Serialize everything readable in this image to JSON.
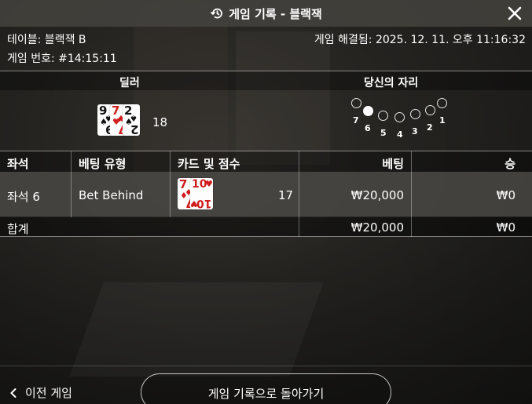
{
  "header": {
    "title": "게임 기록 - 블랙잭",
    "history_icon": "history-icon",
    "close_icon": "close-icon"
  },
  "info": {
    "table": "테이블: 블랙잭 B",
    "round": "게임 번호: #14:15:11",
    "resolved": "게임 해결됨: 2025. 12. 11. 오후 11:16:32"
  },
  "dealer": {
    "label": "딜러",
    "cards": [
      {
        "rank": "9",
        "suit": "♠",
        "color": "black"
      },
      {
        "rank": "7",
        "suit": "♥",
        "color": "red"
      },
      {
        "rank": "2",
        "suit": "♠",
        "color": "black"
      }
    ],
    "score": "18"
  },
  "seats": {
    "label": "당신의 자리",
    "numbers": [
      "7",
      "6",
      "5",
      "4",
      "3",
      "2",
      "1"
    ],
    "active": "6"
  },
  "table": {
    "headers": {
      "seat": "좌석",
      "bet_type": "베팅 유형",
      "cards": "카드 및 점수",
      "bet": "베팅",
      "win": "승"
    },
    "rows": [
      {
        "seat": "좌석 6",
        "bet_type": "Bet Behind",
        "cards": [
          {
            "rank": "7",
            "suit": "♦",
            "color": "red"
          },
          {
            "rank": "10",
            "suit": "♥",
            "color": "red"
          }
        ],
        "score": "17",
        "bet": "₩20,000",
        "win": "₩0"
      }
    ],
    "total": {
      "label": "합계",
      "bet": "₩20,000",
      "win": "₩0"
    }
  },
  "footer": {
    "prev_label": "이전 게임",
    "prev_icon": "chevron-left-icon",
    "back_label": "게임 기록으로 돌아가기"
  },
  "colors": {
    "card_red": "#d11d1d",
    "header_bg": "#464440",
    "row_bg": "#4b4946"
  }
}
